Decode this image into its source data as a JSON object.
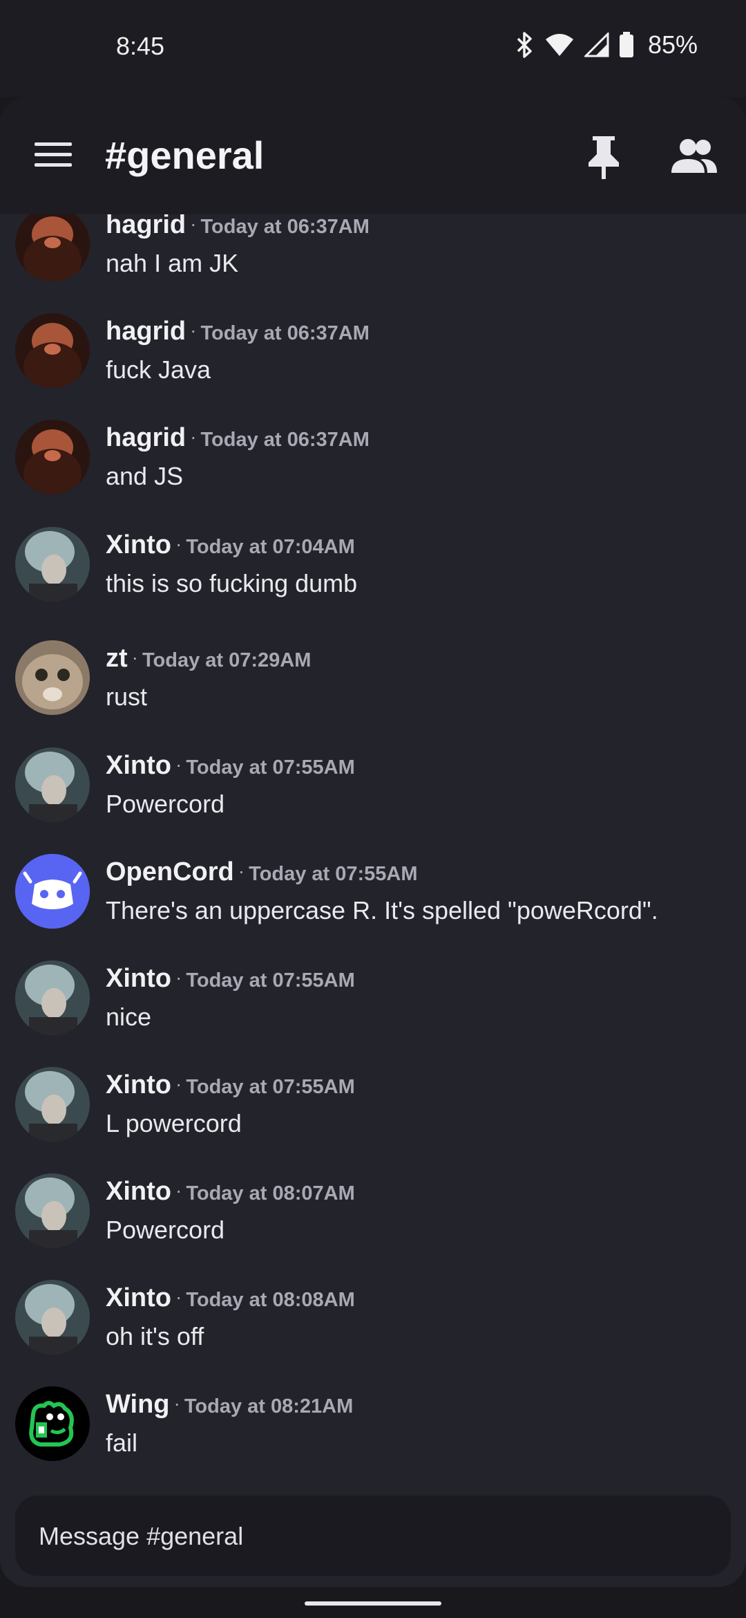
{
  "status_bar": {
    "time": "8:45",
    "battery": "85%",
    "icons": [
      "bluetooth-icon",
      "wifi-icon",
      "cellular-signal-icon",
      "battery-icon"
    ]
  },
  "top_bar": {
    "channel": "#general",
    "icons": [
      "hamburger-menu-icon",
      "pin-icon",
      "members-icon"
    ]
  },
  "messages": [
    {
      "author": "hagrid",
      "timestamp": "Today at 06:37AM",
      "text": "nah I am JK",
      "avatar": "hagrid"
    },
    {
      "author": "hagrid",
      "timestamp": "Today at 06:37AM",
      "text": "fuck Java",
      "avatar": "hagrid"
    },
    {
      "author": "hagrid",
      "timestamp": "Today at 06:37AM",
      "text": "and JS",
      "avatar": "hagrid"
    },
    {
      "author": "Xinto",
      "timestamp": "Today at 07:04AM",
      "text": "this is so fucking dumb",
      "avatar": "xinto"
    },
    {
      "author": "zt",
      "timestamp": "Today at 07:29AM",
      "text": "rust",
      "avatar": "cat"
    },
    {
      "author": "Xinto",
      "timestamp": "Today at 07:55AM",
      "text": "Powercord",
      "avatar": "xinto"
    },
    {
      "author": "OpenCord",
      "timestamp": "Today at 07:55AM",
      "text": "There's an uppercase R. It's spelled \"poweRcord\".",
      "avatar": "bot"
    },
    {
      "author": "Xinto",
      "timestamp": "Today at 07:55AM",
      "text": "nice",
      "avatar": "xinto"
    },
    {
      "author": "Xinto",
      "timestamp": "Today at 07:55AM",
      "text": "L powercord",
      "avatar": "xinto"
    },
    {
      "author": "Xinto",
      "timestamp": "Today at 08:07AM",
      "text": "Powercord",
      "avatar": "xinto"
    },
    {
      "author": "Xinto",
      "timestamp": "Today at 08:08AM",
      "text": "oh it's off",
      "avatar": "xinto"
    },
    {
      "author": "Wing",
      "timestamp": "Today at 08:21AM",
      "text": "fail",
      "avatar": "wing"
    }
  ],
  "composer": {
    "placeholder": "Message #general"
  },
  "colors": {
    "background": "#23232c",
    "bar": "#1c1c22",
    "bot_avatar": "#5865f2",
    "wing_green": "#23c552"
  }
}
